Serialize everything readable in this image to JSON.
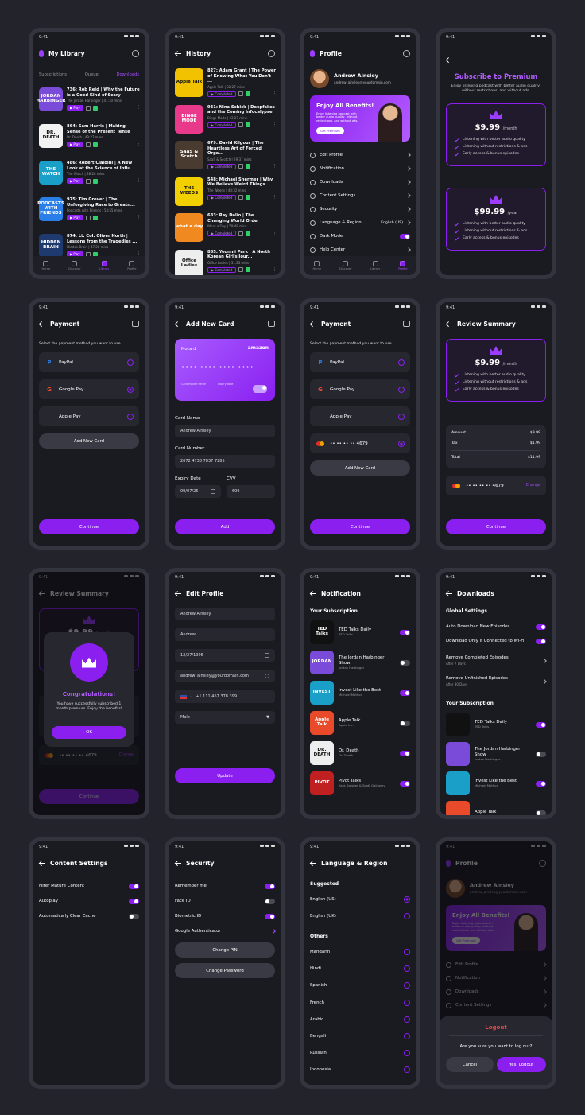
{
  "status_time": "9:41",
  "library": {
    "title": "My Library",
    "tabs": [
      "Subscriptions",
      "Queue",
      "Downloads"
    ],
    "items": [
      {
        "thumb": "JORDAN HARBINGER",
        "color": "#7a4bd8",
        "title": "736: Rob Reid | Why the Future is a Good Kind of Scary",
        "meta": "The Jordan Harbinger | 41:30 mins"
      },
      {
        "thumb": "DR. DEATH",
        "color": "#f2f2f2",
        "title": "864: Sam Harris | Making Sense of the Present Tense",
        "meta": "Dr. Death | 49:27 mins"
      },
      {
        "thumb": "THE WATCH",
        "color": "#1aa0c8",
        "title": "486: Robert Cialdini | A New Look at the Science of Influ...",
        "meta": "The Watch | 38:28 mins"
      },
      {
        "thumb": "PODCASTS WITH FRIENDS",
        "color": "#2a7ee8",
        "title": "975: Tim Grover | The Unforgiving Race to Greatn...",
        "meta": "Podcasts with Friends | 53:55 mins"
      },
      {
        "thumb": "HIDDEN BRAIN",
        "color": "#1e3a6e",
        "title": "874: Lt. Col. Oliver North | Lessons from the Tragedies ...",
        "meta": "Hidden Brain | 47:28 mins"
      }
    ],
    "play": "Play",
    "nav": [
      "Home",
      "Discover",
      "Library",
      "Profile"
    ]
  },
  "history": {
    "title": "History",
    "completed": "Completed",
    "items": [
      {
        "thumb": "Apple Talk",
        "color": "#f2c200",
        "title": "827: Adam Grant | The Power of Knowing What You Don't ...",
        "meta": "Apple Talk | 32:27 mins"
      },
      {
        "thumb": "BINGE MODE",
        "color": "#e8398a",
        "title": "931: Nina Schick | Deepfakes and the Coming Infocalypse",
        "meta": "Binge Mode | 43:27 mins"
      },
      {
        "thumb": "SaaS & Scotch",
        "color": "#4a3b30",
        "title": "679: David Kilgour | The Heartless Art of Forced Orga...",
        "meta": "SaaS & Scotch | 29:37 mins"
      },
      {
        "thumb": "THE WEEDS",
        "color": "#f2d000",
        "title": "548: Michael Shermer | Why We Believe Weird Things",
        "meta": "The Weeds | 48:32 mins"
      },
      {
        "thumb": "what a day",
        "color": "#f08a20",
        "title": "683: Ray Dalio | The Changing World Order",
        "meta": "What a Day | 59:48 mins"
      },
      {
        "thumb": "Office Ladies",
        "color": "#eee",
        "title": "865: Yeonmi Park | A North Korean Girl's Jour...",
        "meta": "Office Ladies | 31:23 mins"
      }
    ]
  },
  "profile": {
    "title": "Profile",
    "name": "Andrew Ainsley",
    "email": "andrew_ainsley@yourdomain.com",
    "promo_title": "Enjoy All Benefits!",
    "promo_text": "Enjoy listening podcast with better audio quality, without restrictions, and without ads.",
    "promo_btn": "Get Premium",
    "menu": [
      "Edit Profile",
      "Notification",
      "Downloads",
      "Content Settings",
      "Security",
      "Language & Region",
      "Dark Mode",
      "Help Center"
    ],
    "lang_value": "English (US)"
  },
  "premium": {
    "title": "Subscribe to Premium",
    "subtitle": "Enjoy listening podcast with better audio quality, without restrictions, and without ads.",
    "plans": [
      {
        "price": "$9.99",
        "period": "/month"
      },
      {
        "price": "$99.99",
        "period": "/year"
      }
    ],
    "features": [
      "Listening with better audio quality",
      "Listening without restrictions & ads",
      "Early access & bonus episodes"
    ]
  },
  "payment": {
    "title": "Payment",
    "subtitle": "Select the payment method you want to use.",
    "methods": [
      "PayPal",
      "Google Pay",
      "Apple Pay"
    ],
    "add": "Add New Card",
    "continue": "Continue",
    "card_masked": "•• •• •• •• 4679"
  },
  "addcard": {
    "title": "Add New Card",
    "brand": "Mocard",
    "brand2": "amazon",
    "card_dots": "•••• •••• •••• ••••",
    "holder_lbl": "Card Holder name",
    "expiry_lbl": "Expiry date",
    "labels": [
      "Card Name",
      "Card Number",
      "Expiry Date",
      "CVV"
    ],
    "values": [
      "Andrew Ainsley",
      "2672 4738 7837 7285",
      "09/07/26",
      "699"
    ],
    "btn": "Add"
  },
  "review": {
    "title": "Review Summary",
    "amount_lbl": "Amount",
    "amount": "$9.99",
    "tax_lbl": "Tax",
    "tax": "$1.99",
    "total_lbl": "Total",
    "total": "$11.99",
    "change": "Change"
  },
  "congrats": {
    "title": "Congratulations!",
    "text": "You have successfully subscribed 1 month premium. Enjoy the benefits!",
    "ok": "OK"
  },
  "editprofile": {
    "title": "Edit Profile",
    "fields": [
      "Andrew Ainsley",
      "Andrew",
      "12/27/1995",
      "andrew_ainsley@yourdomain.com",
      "+1 111 467 378 399",
      "Male"
    ],
    "btn": "Update"
  },
  "notification": {
    "title": "Notification",
    "section": "Your Subscription",
    "items": [
      {
        "name": "TED Talks Daily",
        "sub": "TED Talks",
        "thumb": "TED Talks",
        "color": "#111",
        "on": true
      },
      {
        "name": "The Jordan Harbinger Show",
        "sub": "Jordan Harbinger",
        "thumb": "JORDAN",
        "color": "#7a4bd8",
        "on": false
      },
      {
        "name": "Invest Like the Best",
        "sub": "Michael Mothon",
        "thumb": "INVEST",
        "color": "#1aa0c8",
        "on": true
      },
      {
        "name": "Apple Talk",
        "sub": "Apple Inc.",
        "thumb": "Apple Talk",
        "color": "#e84a2a",
        "on": false
      },
      {
        "name": "Dr. Death",
        "sub": "Dr. Death",
        "thumb": "DR. DEATH",
        "color": "#eee",
        "on": true
      },
      {
        "name": "Pivot Talks",
        "sub": "Kara Swisher & Scott Galloway",
        "thumb": "PIVOT",
        "color": "#c02020",
        "on": true
      }
    ]
  },
  "downloads": {
    "title": "Downloads",
    "section1": "Global Settings",
    "settings": [
      {
        "l": "Auto Download New Episodes",
        "on": true
      },
      {
        "l": "Download Only if Connected to Wi-Fi",
        "on": true
      }
    ],
    "removes": [
      {
        "l": "Remove Completed Episodes",
        "s": "After 7 Days"
      },
      {
        "l": "Remove Unfinished Episodes",
        "s": "After 30 Days"
      }
    ],
    "section2": "Your Subscription",
    "subs": [
      {
        "name": "TED Talks Daily",
        "sub": "TED Talks",
        "on": true
      },
      {
        "name": "The Jordan Harbinger Show",
        "sub": "Jordan Harbinger",
        "on": false
      },
      {
        "name": "Invest Like the Best",
        "sub": "Michael Mothon",
        "on": true
      },
      {
        "name": "Apple Talk",
        "sub": "",
        "on": false
      }
    ]
  },
  "content": {
    "title": "Content Settings",
    "items": [
      {
        "l": "Filter Mature Content",
        "on": true
      },
      {
        "l": "Autoplay",
        "on": true
      },
      {
        "l": "Automatically Clear Cache",
        "on": false
      }
    ]
  },
  "security": {
    "title": "Security",
    "items": [
      {
        "l": "Remember me",
        "on": true
      },
      {
        "l": "Face ID",
        "on": false
      },
      {
        "l": "Biometric ID",
        "on": true
      }
    ],
    "ga": "Google Authenticator",
    "pin": "Change PIN",
    "pwd": "Change Password"
  },
  "language": {
    "title": "Language & Region",
    "suggested": "Suggested",
    "others": "Others",
    "sugg": [
      "English (US)",
      "English (UK)"
    ],
    "list": [
      "Mandarin",
      "Hindi",
      "Spanish",
      "French",
      "Arabic",
      "Bengali",
      "Russian",
      "Indonesia"
    ]
  },
  "logout": {
    "title": "Logout",
    "text": "Are you sure you want to log out?",
    "cancel": "Cancel",
    "yes": "Yes, Logout"
  }
}
